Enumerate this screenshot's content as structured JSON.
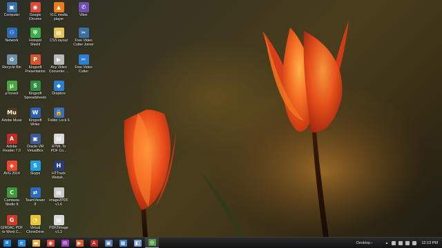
{
  "desktop": {
    "icons": [
      {
        "id": "computer",
        "label": "Computer",
        "color": "#3a6ea8",
        "glyph": "▣"
      },
      {
        "id": "google-chrome",
        "label": "Google\nChrome",
        "color": "#d94a3a",
        "glyph": "◉"
      },
      {
        "id": "vlc",
        "label": "VLC media\nplayer",
        "color": "#ee7c16",
        "glyph": "▲"
      },
      {
        "id": "viber",
        "label": "Viber",
        "color": "#6f4fb3",
        "glyph": "✆"
      },
      {
        "id": "network",
        "label": "Network",
        "color": "#2d6cb5",
        "glyph": "⚇"
      },
      {
        "id": "hotspot-shield",
        "label": "Hotspot\nShield",
        "color": "#3cab4a",
        "glyph": "⛨"
      },
      {
        "id": "css-layout",
        "label": "CSS layout",
        "color": "#e4c25a",
        "glyph": "▤"
      },
      {
        "id": "free-video-cutter-joiner",
        "label": "Free Video\nCutter Joiner",
        "color": "#3b6fa0",
        "glyph": "✂"
      },
      {
        "id": "recycle-bin",
        "label": "Recycle Bin",
        "color": "#6f8fa8",
        "glyph": "♻"
      },
      {
        "id": "kingsoft-presentation",
        "label": "Kingsoft\nPresentation",
        "color": "#d7552e",
        "glyph": "P"
      },
      {
        "id": "any-video-converter",
        "label": "Any Video\nConverter ...",
        "color": "#b9b9b9",
        "glyph": "▶"
      },
      {
        "id": "free-video-cutter",
        "label": "Free Video\nCutter",
        "color": "#2e7dd1",
        "glyph": "✂"
      },
      {
        "id": "utorrent",
        "label": "µTorrent",
        "color": "#4aa53c",
        "glyph": "µ"
      },
      {
        "id": "kingsoft-spreadsheets",
        "label": "Kingsoft\nSpreadsheets",
        "color": "#2f8f3f",
        "glyph": "S"
      },
      {
        "id": "dropbox",
        "label": "Dropbox",
        "color": "#2d7fd3",
        "glyph": "◆"
      },
      {
        "id": "adobe-muse",
        "label": "Adobe Muse",
        "color": "#4c3b1f",
        "glyph": "Mu"
      },
      {
        "id": "kingsoft-writer",
        "label": "Kingsoft\nWriter",
        "color": "#2f5fb2",
        "glyph": "W"
      },
      {
        "id": "folder-lock",
        "label": "Folder Lock 6",
        "color": "#3e6fb0",
        "glyph": "🔒"
      },
      {
        "id": "adobe-reader",
        "label": "Adobe\nReader 7.0",
        "color": "#c22a25",
        "glyph": "A"
      },
      {
        "id": "oracle-vm-virtualbox",
        "label": "Oracle VM\nVirtualBox",
        "color": "#3a5d9a",
        "glyph": "▣"
      },
      {
        "id": "html-to-pdf",
        "label": "HTML To\nPDF Co...",
        "color": "#d9d9d9",
        "glyph": "▤"
      },
      {
        "id": "avg-2014",
        "label": "AVG 2014",
        "color": "#e5492f",
        "glyph": "◈"
      },
      {
        "id": "skype",
        "label": "Skype",
        "color": "#1e9fdf",
        "glyph": "S"
      },
      {
        "id": "httrack",
        "label": "HTTrack\nWebsit...",
        "color": "#2b3b73",
        "glyph": "H"
      },
      {
        "id": "camtasia",
        "label": "Camtasia\nStudio 8",
        "color": "#3c9a3a",
        "glyph": "C"
      },
      {
        "id": "teamviewer",
        "label": "TeamViewer\n8",
        "color": "#2b6dbd",
        "glyph": "⇄"
      },
      {
        "id": "image2pdf",
        "label": "image2PDF\nv1.6",
        "color": "#c8c8c8",
        "glyph": "▤"
      },
      {
        "id": "girdac-pdf",
        "label": "GIRDAC PDF\nto Word C...",
        "color": "#cf3b2b",
        "glyph": "G"
      },
      {
        "id": "virtual-clonedrive",
        "label": "Virtual\nCloneDrive",
        "color": "#e6c330",
        "glyph": "◔"
      },
      {
        "id": "pdf2image",
        "label": "PDF2Image\nv1.3",
        "color": "#d8d8d8",
        "glyph": "▤"
      }
    ]
  },
  "taskbar": {
    "buttons": [
      {
        "id": "ie",
        "glyph": "e",
        "color": "#2a8ee0",
        "active": false
      },
      {
        "id": "explorer",
        "glyph": "▬",
        "color": "#e1b54a",
        "active": false
      },
      {
        "id": "chrome",
        "glyph": "◉",
        "color": "#d94a3a",
        "active": false
      },
      {
        "id": "mail",
        "glyph": "✉",
        "color": "#9a3dbb",
        "active": false
      },
      {
        "id": "media",
        "glyph": "▶",
        "color": "#d9622b",
        "active": false
      },
      {
        "id": "adobe",
        "glyph": "A",
        "color": "#b02a2a",
        "active": false
      },
      {
        "id": "screenshot",
        "glyph": "▣",
        "color": "#5a7fae",
        "active": false
      },
      {
        "id": "network",
        "glyph": "▦",
        "color": "#3e7ec2",
        "active": false
      },
      {
        "id": "window",
        "glyph": "◧",
        "color": "#7aa0d0",
        "active": false
      },
      {
        "id": "camtasia",
        "glyph": "◎",
        "color": "#5aa04a",
        "active": true
      }
    ],
    "tray": {
      "desktop_label": "Desktop",
      "clock": "12:13 PM"
    }
  },
  "colors": {
    "taskbar_bg": "#1a1a1a",
    "petal": "#e8531c"
  }
}
